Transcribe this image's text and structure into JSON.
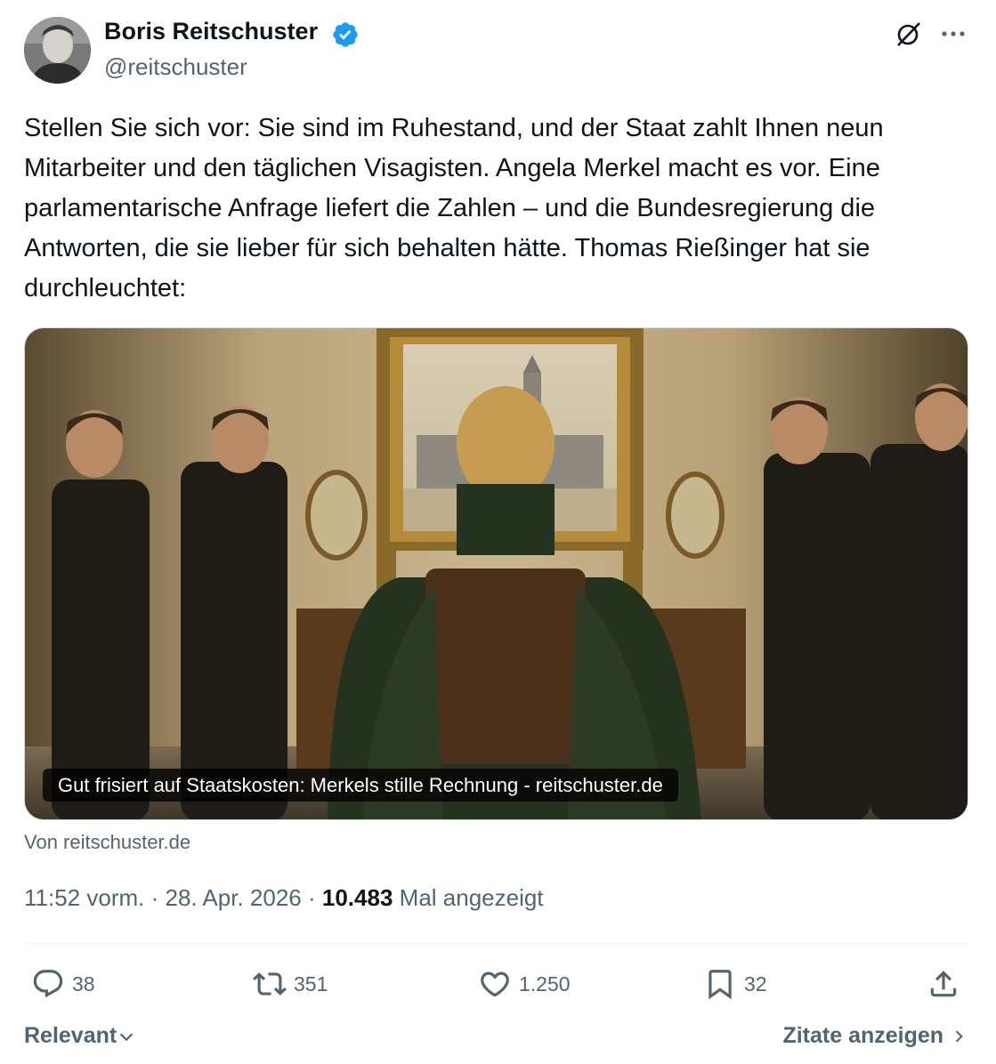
{
  "author": {
    "name": "Boris Reitschuster",
    "handle": "@reitschuster",
    "verified_color": "#1d9bf0"
  },
  "tweet": {
    "text": "Stellen Sie sich vor: Sie sind im Ruhestand, und der Staat zahlt Ihnen neun Mitarbeiter und den täglichen Visagisten. Angela Merkel macht es vor. Eine parlamentarische Anfrage liefert die Zahlen – und die Bundesregierung die Antworten, die sie lieber für sich behalten hätte. Thomas Rießinger hat sie durchleuchtet:"
  },
  "card": {
    "caption": "Gut frisiert auf Staatskosten: Merkels stille Rechnung - reitschuster.de",
    "source": "Von reitschuster.de"
  },
  "meta": {
    "time": "11:52 vorm.",
    "date": "28. Apr. 2026",
    "views": "10.483",
    "views_label": "Mal angezeigt",
    "sep": "·"
  },
  "actions": {
    "replies": "38",
    "reposts": "351",
    "likes": "1.250",
    "bookmarks": "32"
  },
  "footer": {
    "sort_label": "Relevant",
    "quotes_link": "Zitate anzeigen"
  },
  "icons": [
    "verified-icon",
    "grok-icon",
    "more-icon",
    "reply-icon",
    "repost-icon",
    "like-icon",
    "bookmark-icon",
    "share-icon",
    "chevron-down-icon",
    "chevron-right-icon"
  ]
}
